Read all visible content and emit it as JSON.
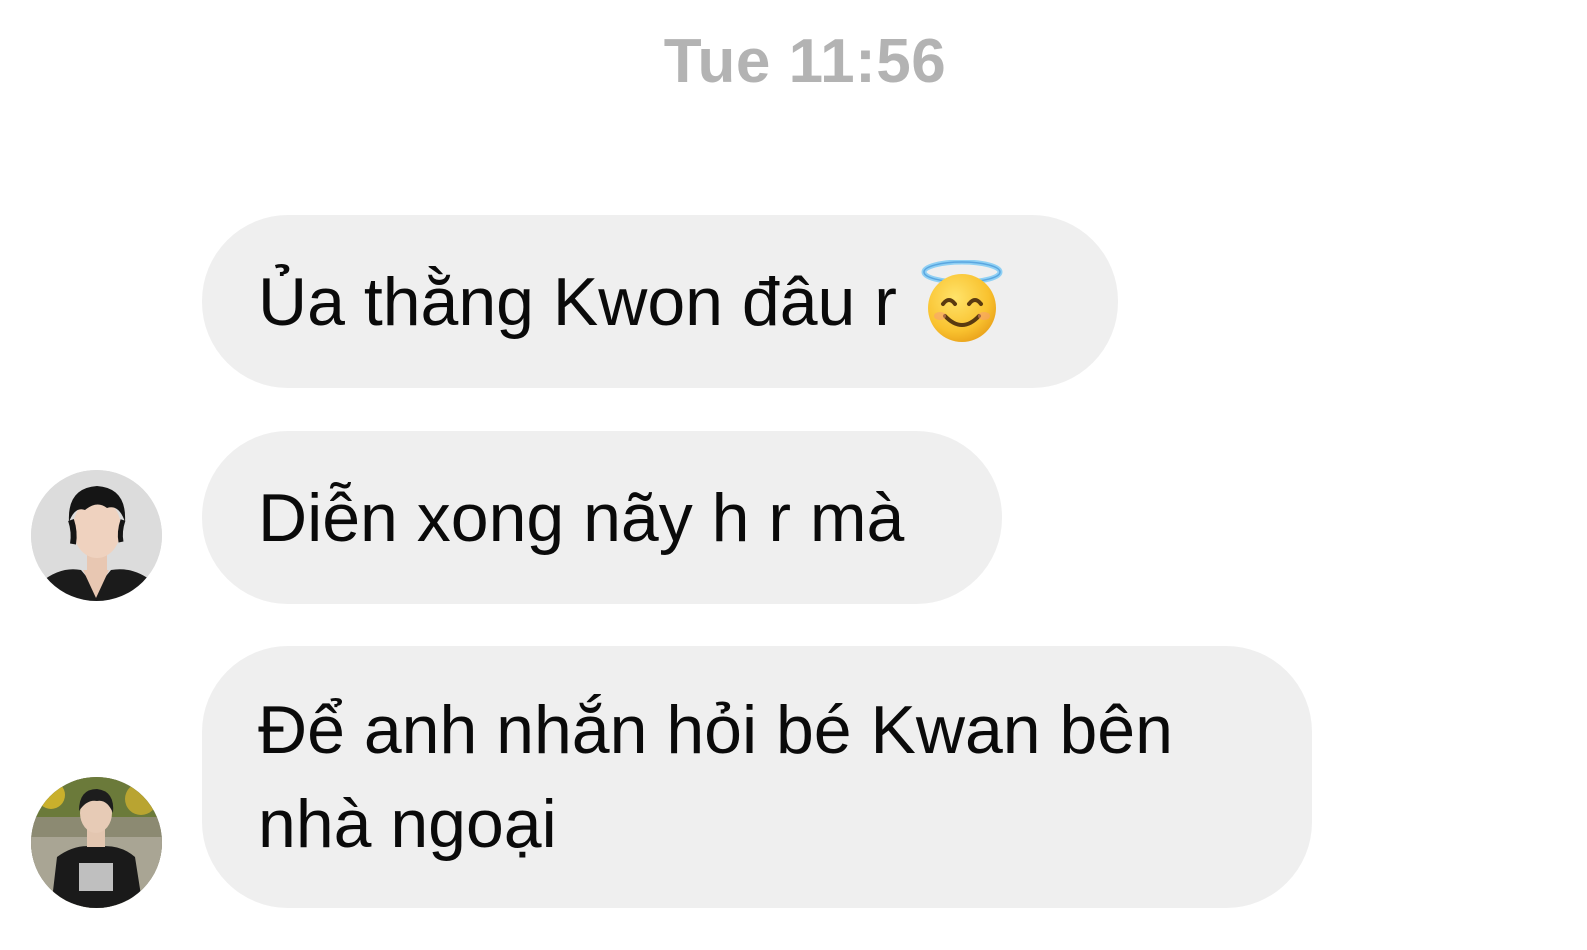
{
  "timestamp": "Tue 11:56",
  "messages": [
    {
      "text": "Ủa thằng Kwon đâu r",
      "emoji": "smiling-face-with-halo"
    },
    {
      "text": "Diễn xong nãy h r mà"
    },
    {
      "text": "Để anh nhắn hỏi bé Kwan bên nhà ngoại"
    }
  ],
  "colors": {
    "bubble_bg": "#efefef",
    "timestamp": "#b3b3b3",
    "text": "#0a0a0a"
  }
}
